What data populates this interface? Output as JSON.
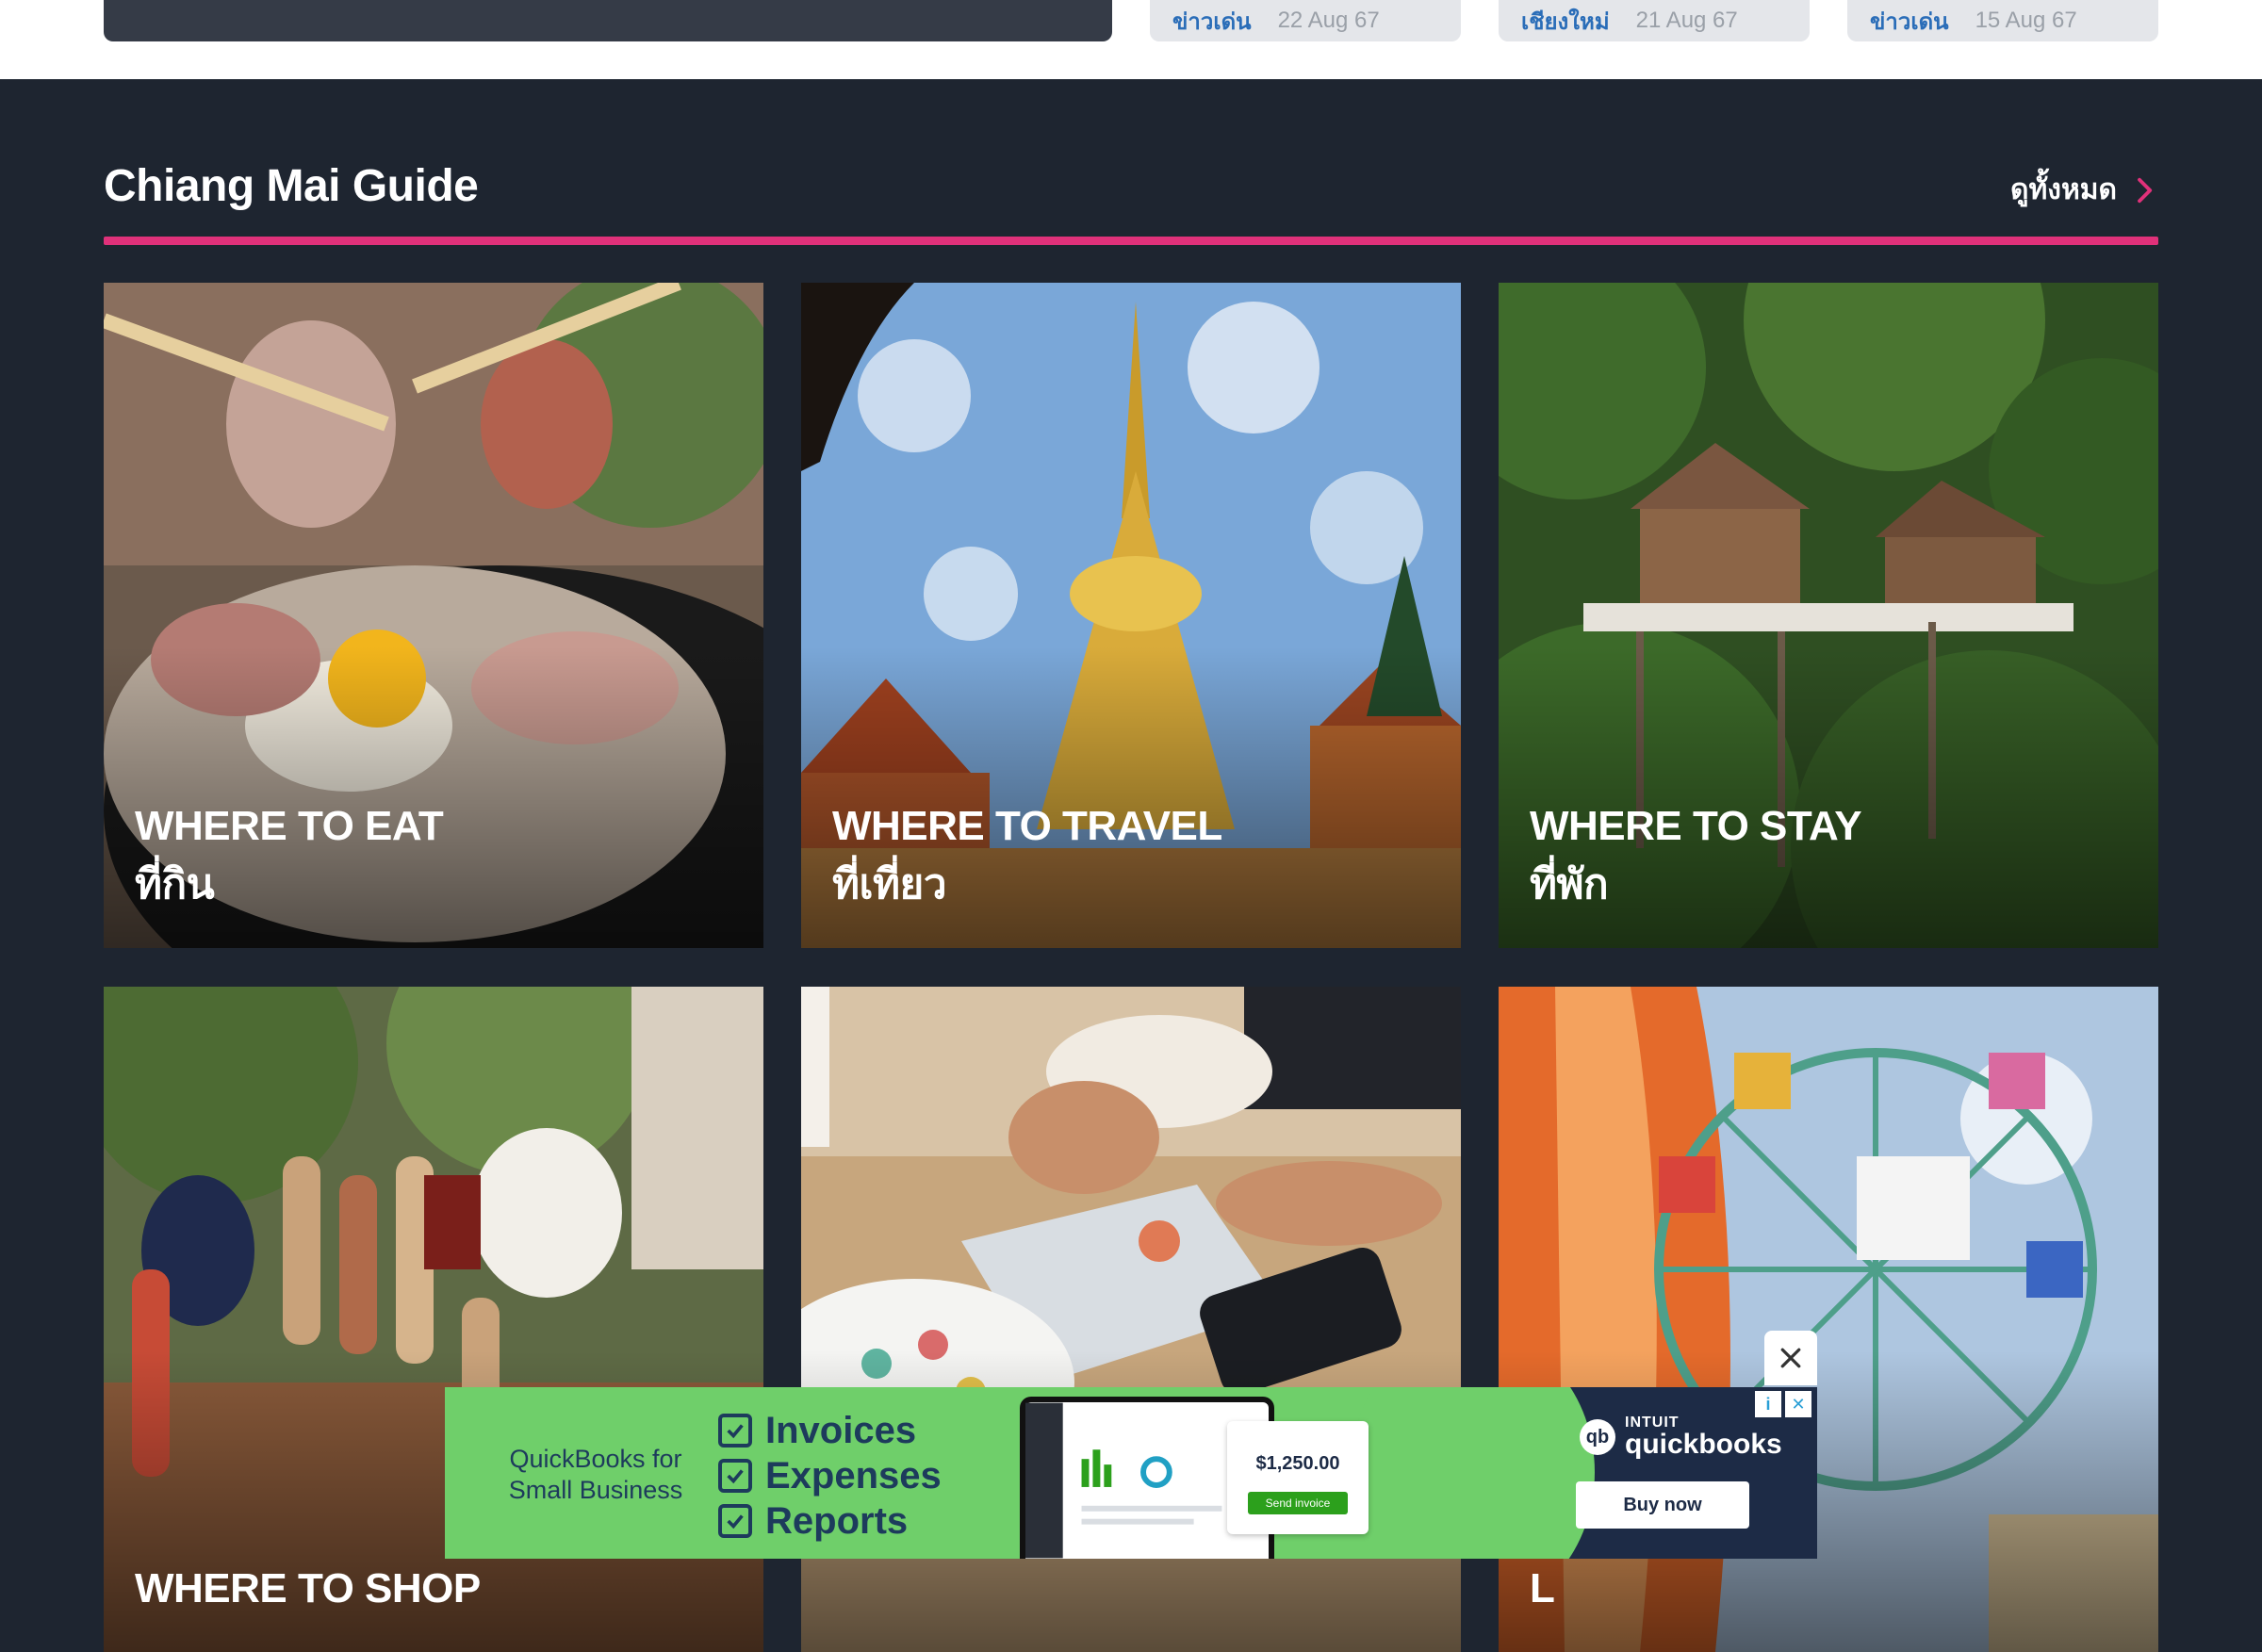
{
  "top_news": [
    {
      "category": "ข่าวเด่น",
      "date": "22 Aug 67"
    },
    {
      "category": "เชียงใหม่",
      "date": "21 Aug 67"
    },
    {
      "category": "ข่าวเด่น",
      "date": "15 Aug 67"
    }
  ],
  "guide": {
    "title": "Chiang Mai Guide",
    "see_all": "ดูทั้งหมด",
    "accent_color": "#e0317a",
    "cards": [
      {
        "en": "WHERE TO EAT",
        "th": "ที่กิน"
      },
      {
        "en": "WHERE TO TRAVEL",
        "th": "ที่เที่ยว"
      },
      {
        "en": "WHERE TO STAY",
        "th": "ที่พัก"
      },
      {
        "en": "WHERE TO SHOP",
        "th": ""
      },
      {
        "en": "",
        "th": ""
      },
      {
        "en": "L",
        "th": ""
      }
    ]
  },
  "ad": {
    "tagline": "QuickBooks for Small Business",
    "features": [
      "Invoices",
      "Expenses",
      "Reports"
    ],
    "invoice_amount": "$1,250.00",
    "send_label": "Send invoice",
    "brand_top": "INTUIT",
    "brand_name": "quickbooks",
    "cta": "Buy now"
  }
}
